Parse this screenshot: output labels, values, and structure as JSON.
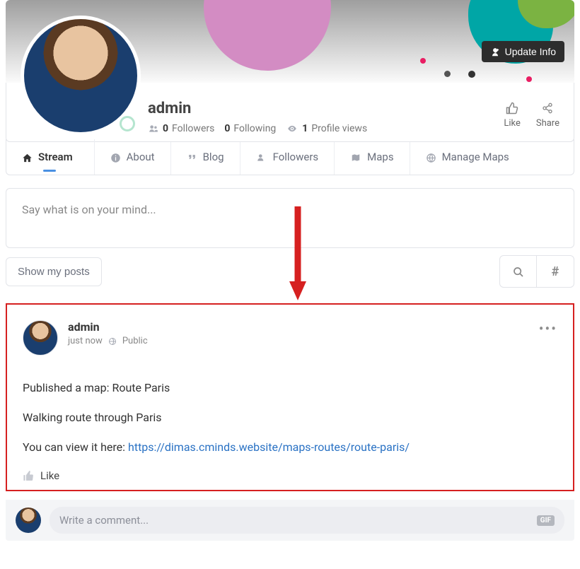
{
  "header": {
    "update_btn": "Update Info",
    "name": "admin",
    "stats": {
      "followers_count": "0",
      "followers_label": "Followers",
      "following_count": "0",
      "following_label": "Following",
      "views_count": "1",
      "views_label": "Profile views"
    },
    "actions": {
      "like": "Like",
      "share": "Share"
    }
  },
  "tabs": {
    "stream": "Stream",
    "about": "About",
    "blog": "Blog",
    "followers": "Followers",
    "maps": "Maps",
    "manage_maps": "Manage Maps"
  },
  "composer": {
    "placeholder": "Say what is on your mind..."
  },
  "filters": {
    "show_my_posts": "Show my posts"
  },
  "post": {
    "author": "admin",
    "time": "just now",
    "visibility": "Public",
    "line1": "Published a map: Route Paris",
    "line2": "Walking route through Paris",
    "line3_prefix": "You can view it here: ",
    "link_text": "https://dimas.cminds.website/maps-routes/route-paris/",
    "like_label": "Like"
  },
  "comment": {
    "placeholder": "Write a comment...",
    "gif": "GIF"
  }
}
